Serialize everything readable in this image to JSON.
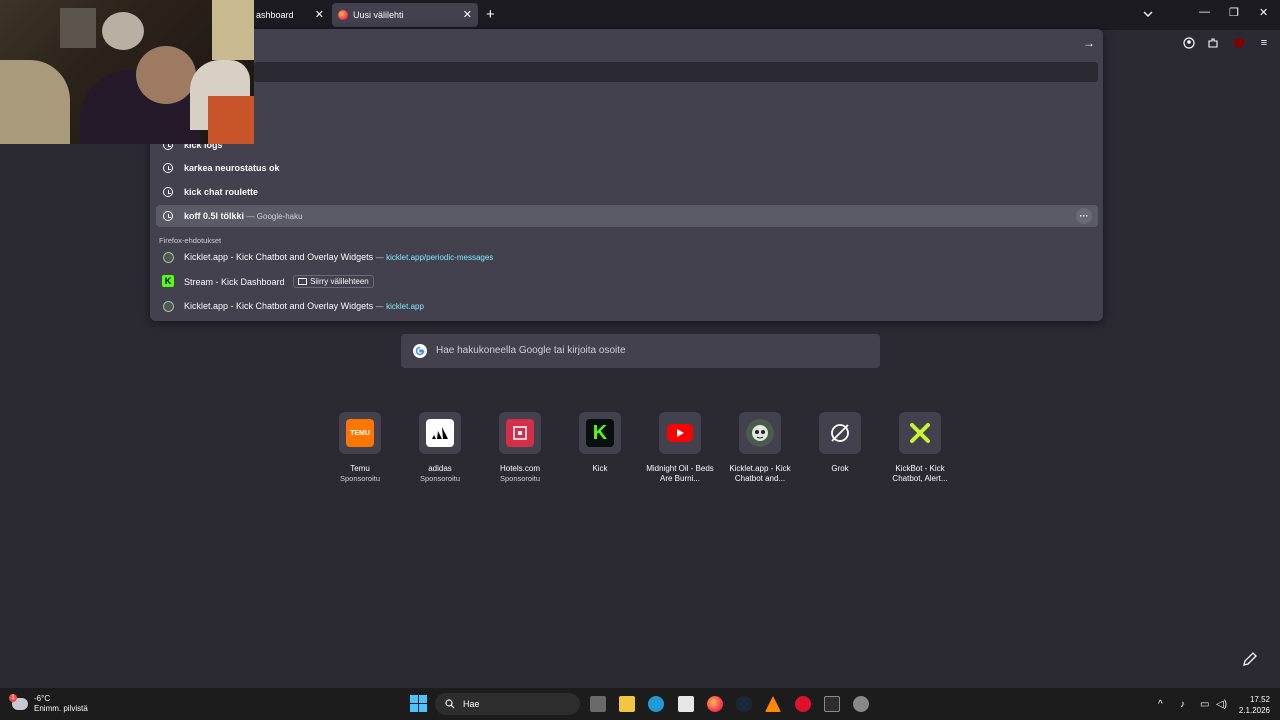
{
  "tabs": [
    {
      "label": "ashboard"
    },
    {
      "label": "Uusi välilehti"
    }
  ],
  "urlbar": {
    "history": [
      {
        "text": "kick logs"
      },
      {
        "text": "karkea neurostatus ok"
      },
      {
        "text": "kick chat roulette"
      },
      {
        "text": "koff 0.5l tölkki",
        "suffix": "— Google-haku"
      }
    ],
    "section_label": "Firefox-ehdotukset",
    "suggestions": [
      {
        "title": "Kicklet.app - Kick Chatbot and Overlay Widgets",
        "dash": "—",
        "url": "kicklet.app/periodic-messages"
      },
      {
        "title": "Stream - Kick Dashboard",
        "switch_label": "Siirry välilehteen"
      },
      {
        "title": "Kicklet.app - Kick Chatbot and Overlay Widgets",
        "dash": "—",
        "url": "kicklet.app"
      }
    ]
  },
  "newtab": {
    "search_placeholder": "Hae hakukoneella Google tai kirjoita osoite",
    "shortcuts": [
      {
        "name": "Temu",
        "sub": "Sponsoroitu",
        "icon": "temu-icon",
        "color": "#fb7701"
      },
      {
        "name": "adidas",
        "sub": "Sponsoroitu",
        "icon": "adidas-icon",
        "color": "#ffffff"
      },
      {
        "name": "Hotels.com",
        "sub": "Sponsoroitu",
        "icon": "hotels-icon",
        "color": "#d32f4a"
      },
      {
        "name": "Kick",
        "sub": "",
        "icon": "kick-icon",
        "color": "#53fc18"
      },
      {
        "name": "Midnight Oil - Beds Are Burni...",
        "sub": "",
        "icon": "youtube-icon",
        "color": "#ff0000"
      },
      {
        "name": "Kicklet.app - Kick Chatbot and...",
        "sub": "",
        "icon": "kicklet-icon",
        "color": "#4b5b4e"
      },
      {
        "name": "Grok",
        "sub": "",
        "icon": "grok-icon",
        "color": "#ffffff"
      },
      {
        "name": "KickBot - Kick Chatbot, Alert...",
        "sub": "",
        "icon": "kickbot-icon",
        "color": "#c6f433"
      }
    ]
  },
  "taskbar": {
    "weather_temp": "-6°C",
    "weather_desc": "Enimm. pilvistä",
    "search_label": "Hae",
    "time": "17.52",
    "date": "2.1.2026",
    "notification_count": "1"
  }
}
